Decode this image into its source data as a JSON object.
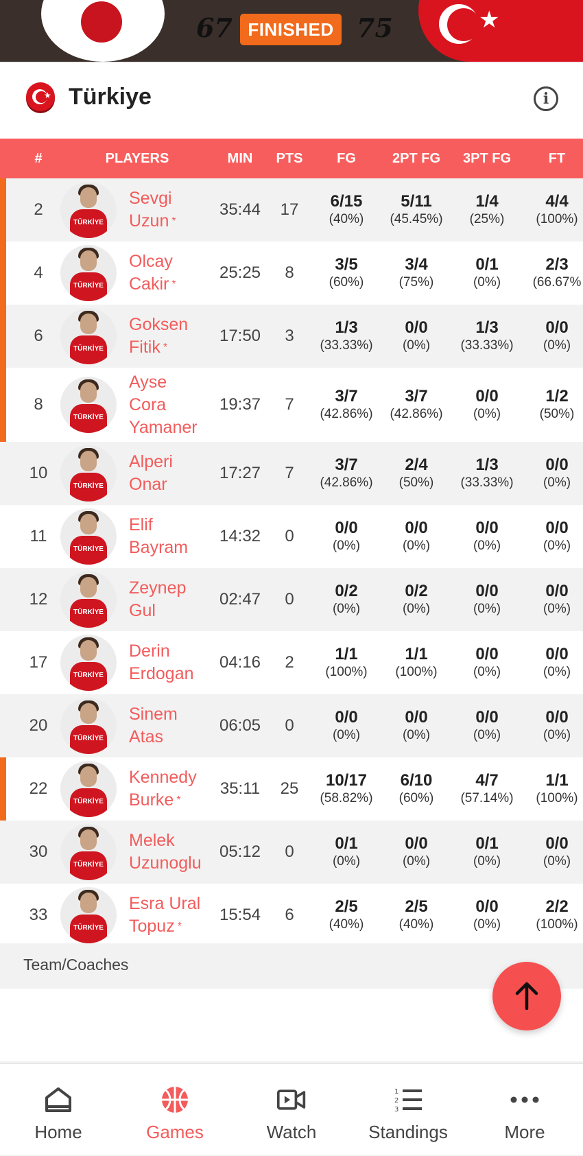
{
  "game": {
    "home_score": "67",
    "away_score": "75",
    "status": "FINISHED"
  },
  "team": {
    "name": "Türkiye"
  },
  "columns": [
    "#",
    "PLAYERS",
    "MIN",
    "PTS",
    "FG",
    "2PT FG",
    "3PT FG",
    "FT"
  ],
  "players": [
    {
      "num": "2",
      "name": [
        "Sevgi",
        "Uzun"
      ],
      "starter": true,
      "min": "35:44",
      "pts": "17",
      "fg": [
        "6/15",
        "(40%)"
      ],
      "fg2": [
        "5/11",
        "(45.45%)"
      ],
      "fg3": [
        "1/4",
        "(25%)"
      ],
      "ft": [
        "4/4",
        "(100%)"
      ]
    },
    {
      "num": "4",
      "name": [
        "Olcay",
        "Cakir"
      ],
      "starter": true,
      "min": "25:25",
      "pts": "8",
      "fg": [
        "3/5",
        "(60%)"
      ],
      "fg2": [
        "3/4",
        "(75%)"
      ],
      "fg3": [
        "0/1",
        "(0%)"
      ],
      "ft": [
        "2/3",
        "(66.67%"
      ]
    },
    {
      "num": "6",
      "name": [
        "Goksen",
        "Fitik"
      ],
      "starter": true,
      "min": "17:50",
      "pts": "3",
      "fg": [
        "1/3",
        "(33.33%)"
      ],
      "fg2": [
        "0/0",
        "(0%)"
      ],
      "fg3": [
        "1/3",
        "(33.33%)"
      ],
      "ft": [
        "0/0",
        "(0%)"
      ]
    },
    {
      "num": "8",
      "name": [
        "Ayse",
        "Cora",
        "Yamaner"
      ],
      "starter": false,
      "min": "19:37",
      "pts": "7",
      "fg": [
        "3/7",
        "(42.86%)"
      ],
      "fg2": [
        "3/7",
        "(42.86%)"
      ],
      "fg3": [
        "0/0",
        "(0%)"
      ],
      "ft": [
        "1/2",
        "(50%)"
      ]
    },
    {
      "num": "10",
      "name": [
        "Alperi",
        "Onar"
      ],
      "starter": false,
      "min": "17:27",
      "pts": "7",
      "fg": [
        "3/7",
        "(42.86%)"
      ],
      "fg2": [
        "2/4",
        "(50%)"
      ],
      "fg3": [
        "1/3",
        "(33.33%)"
      ],
      "ft": [
        "0/0",
        "(0%)"
      ]
    },
    {
      "num": "11",
      "name": [
        "Elif",
        "Bayram"
      ],
      "starter": false,
      "min": "14:32",
      "pts": "0",
      "fg": [
        "0/0",
        "(0%)"
      ],
      "fg2": [
        "0/0",
        "(0%)"
      ],
      "fg3": [
        "0/0",
        "(0%)"
      ],
      "ft": [
        "0/0",
        "(0%)"
      ]
    },
    {
      "num": "12",
      "name": [
        "Zeynep",
        "Gul"
      ],
      "starter": false,
      "min": "02:47",
      "pts": "0",
      "fg": [
        "0/2",
        "(0%)"
      ],
      "fg2": [
        "0/2",
        "(0%)"
      ],
      "fg3": [
        "0/0",
        "(0%)"
      ],
      "ft": [
        "0/0",
        "(0%)"
      ]
    },
    {
      "num": "17",
      "name": [
        "Derin",
        "Erdogan"
      ],
      "starter": false,
      "min": "04:16",
      "pts": "2",
      "fg": [
        "1/1",
        "(100%)"
      ],
      "fg2": [
        "1/1",
        "(100%)"
      ],
      "fg3": [
        "0/0",
        "(0%)"
      ],
      "ft": [
        "0/0",
        "(0%)"
      ]
    },
    {
      "num": "20",
      "name": [
        "Sinem",
        "Atas"
      ],
      "starter": false,
      "min": "06:05",
      "pts": "0",
      "fg": [
        "0/0",
        "(0%)"
      ],
      "fg2": [
        "0/0",
        "(0%)"
      ],
      "fg3": [
        "0/0",
        "(0%)"
      ],
      "ft": [
        "0/0",
        "(0%)"
      ]
    },
    {
      "num": "22",
      "name": [
        "Kennedy",
        "Burke"
      ],
      "starter": true,
      "min": "35:11",
      "pts": "25",
      "fg": [
        "10/17",
        "(58.82%)"
      ],
      "fg2": [
        "6/10",
        "(60%)"
      ],
      "fg3": [
        "4/7",
        "(57.14%)"
      ],
      "ft": [
        "1/1",
        "(100%)"
      ]
    },
    {
      "num": "30",
      "name": [
        "Melek",
        "Uzunoglu"
      ],
      "starter": false,
      "min": "05:12",
      "pts": "0",
      "fg": [
        "0/1",
        "(0%)"
      ],
      "fg2": [
        "0/0",
        "(0%)"
      ],
      "fg3": [
        "0/1",
        "(0%)"
      ],
      "ft": [
        "0/0",
        "(0%)"
      ]
    },
    {
      "num": "33",
      "name": [
        "Esra Ural",
        "Topuz"
      ],
      "starter": true,
      "min": "15:54",
      "pts": "6",
      "fg": [
        "2/5",
        "(40%)"
      ],
      "fg2": [
        "2/5",
        "(40%)"
      ],
      "fg3": [
        "0/0",
        "(0%)"
      ],
      "ft": [
        "2/2",
        "(100%)"
      ]
    }
  ],
  "avatar_jersey_text": "TÜRKİYE",
  "starter_marker": "*",
  "footer": {
    "team_coaches_label": "Team/Coaches"
  },
  "nav": [
    {
      "label": "Home",
      "icon": "home-icon",
      "active": false
    },
    {
      "label": "Games",
      "icon": "basketball-icon",
      "active": true
    },
    {
      "label": "Watch",
      "icon": "video-icon",
      "active": false
    },
    {
      "label": "Standings",
      "icon": "ranked-list-icon",
      "active": false
    },
    {
      "label": "More",
      "icon": "more-dots-icon",
      "active": false
    }
  ],
  "colors": {
    "accent": "#f25c5c",
    "header_red": "#f85d5d",
    "starter_bar": "#f26a1b",
    "badge_orange": "#f26a1b"
  }
}
